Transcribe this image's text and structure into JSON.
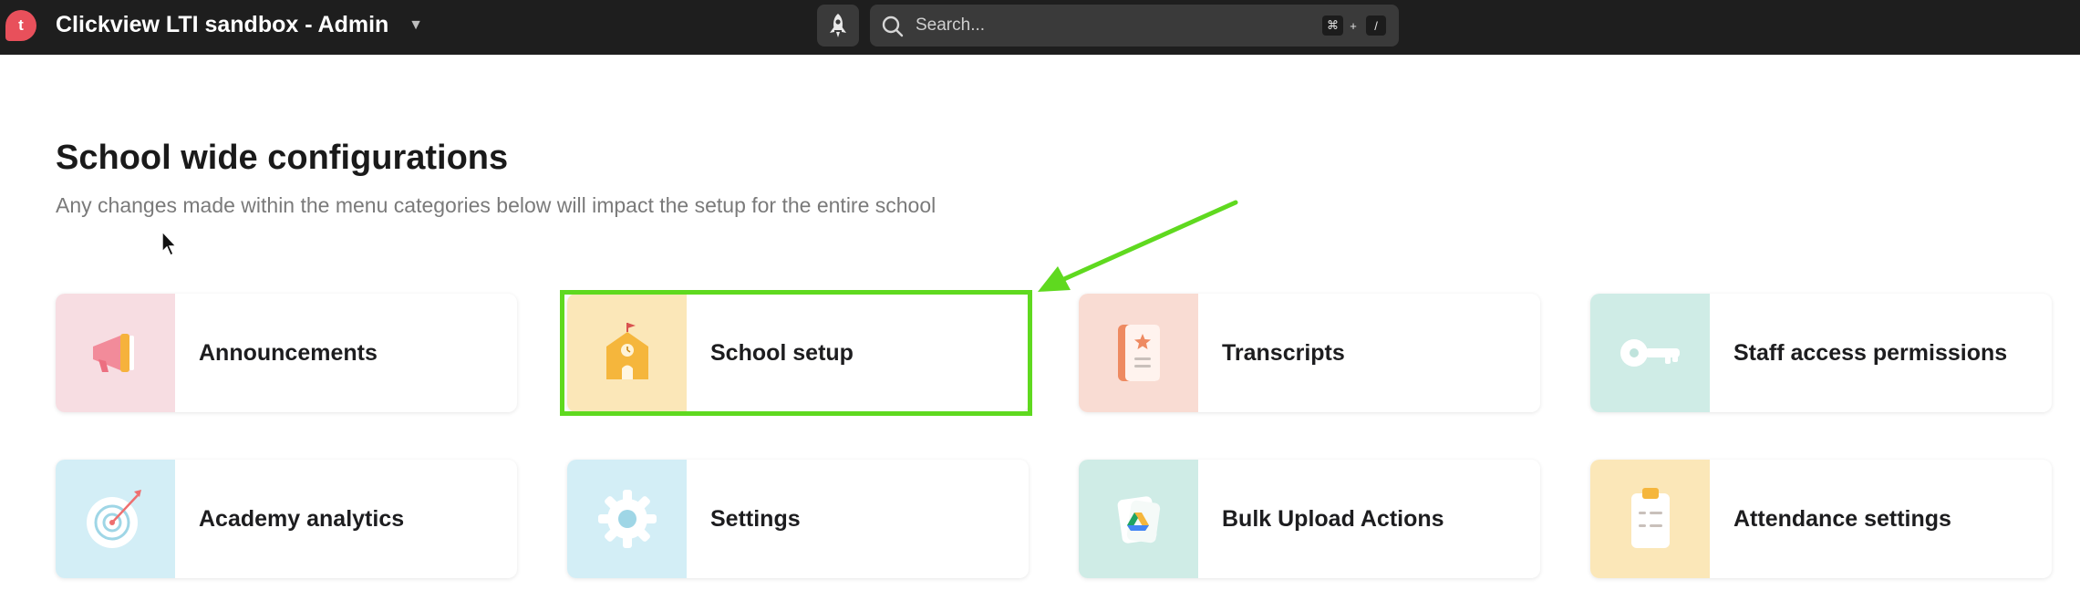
{
  "header": {
    "logo_letter": "t",
    "app_title": "Clickview LTI sandbox - Admin",
    "search": {
      "placeholder": "Search...",
      "shortcut_keys": [
        "⌘",
        "+",
        "/"
      ]
    }
  },
  "page": {
    "title": "School wide configurations",
    "subtitle": "Any changes made within the menu categories below will impact the setup for the entire school"
  },
  "cards": [
    {
      "label": "Announcements",
      "icon": "megaphone-icon",
      "color": "#f7dde2"
    },
    {
      "label": "School setup",
      "icon": "school-building-icon",
      "color": "#fbe7b8"
    },
    {
      "label": "Transcripts",
      "icon": "transcript-book-icon",
      "color": "#f9dcd3"
    },
    {
      "label": "Staff access permissions",
      "icon": "key-icon",
      "color": "#cfece6"
    },
    {
      "label": "Academy analytics",
      "icon": "target-icon",
      "color": "#d3eef6"
    },
    {
      "label": "Settings",
      "icon": "gear-icon",
      "color": "#d3eef6"
    },
    {
      "label": "Bulk Upload Actions",
      "icon": "cloud-drive-icon",
      "color": "#cfece6"
    },
    {
      "label": "Attendance settings",
      "icon": "clipboard-icon",
      "color": "#fbe7b8"
    }
  ],
  "annotation": {
    "highlight_color": "#5fd91f"
  }
}
